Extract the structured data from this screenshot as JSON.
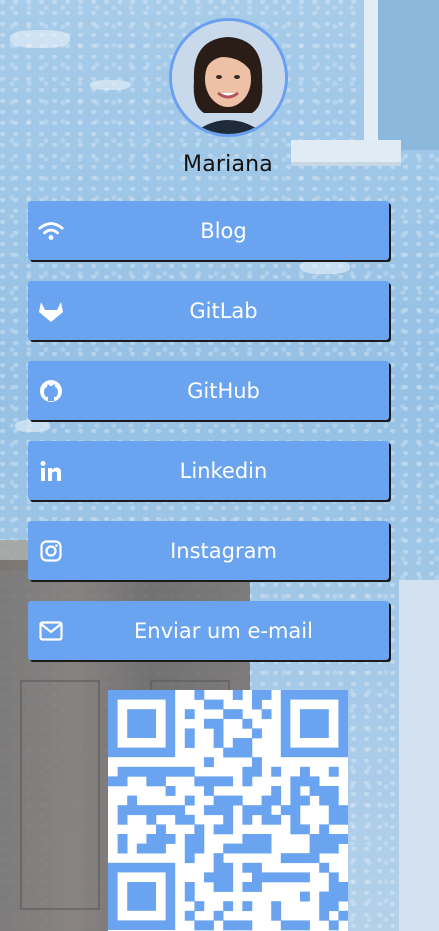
{
  "profile": {
    "name": "Mariana",
    "avatar_alt": "profile-photo"
  },
  "links": [
    {
      "label": "Blog",
      "icon": "wifi-icon"
    },
    {
      "label": "GitLab",
      "icon": "gitlab-icon"
    },
    {
      "label": "GitHub",
      "icon": "github-icon"
    },
    {
      "label": "Linkedin",
      "icon": "linkedin-icon"
    },
    {
      "label": "Instagram",
      "icon": "instagram-icon"
    },
    {
      "label": "Enviar um e-mail",
      "icon": "mail-icon"
    }
  ],
  "qr": {
    "icon": "qr-code"
  },
  "colors": {
    "button": "#6aa4f0",
    "button_text": "#ffffff",
    "accent": "#6ba0f0",
    "qr": "#6aa4f0"
  }
}
